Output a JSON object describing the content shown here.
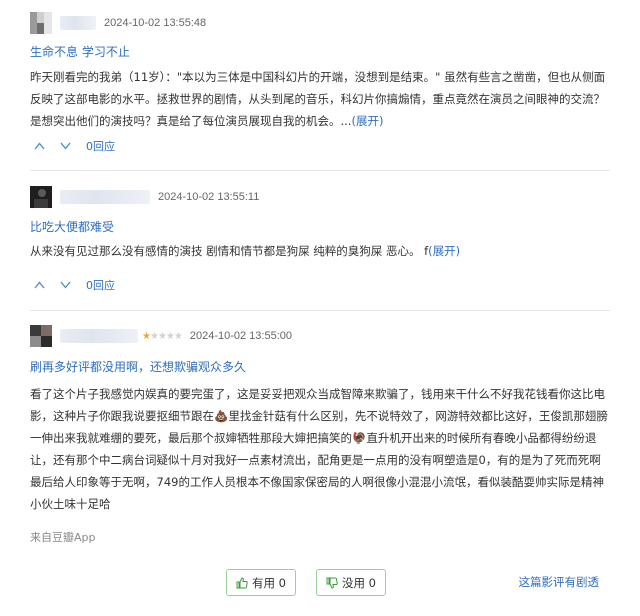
{
  "reviews": [
    {
      "time": "2024-10-02 13:55:48",
      "title": "生命不息 学习不止",
      "content": "昨天刚看完的我弟（11岁）：\"本以为三体是中国科幻片的开端，没想到是结束。\" 虽然有些言之凿凿，但也从侧面反映了这部电影的水平。拯救世界的剧情，从头到尾的音乐，科幻片你搞煽情，重点竟然在演员之间眼神的交流？是想突出他们的演技吗？真是给了每位演员展现自我的机会。...",
      "expand": "(展开)",
      "reply": "0回应"
    },
    {
      "time": "2024-10-02 13:55:11",
      "title": "比吃大便都难受",
      "content": "从来没有见过那么没有感情的演技 剧情和情节都是狗屎 纯粹的臭狗屎 恶心。 f",
      "expand": "(展开)",
      "reply": "0回应"
    },
    {
      "time": "2024-10-02 13:55:00",
      "rating": 1,
      "title": "刷再多好评都没用啊，还想欺骗观众多久",
      "content": "看了这个片子我感觉内娱真的要完蛋了，这是妥妥把观众当成智障来欺骗了，钱用来干什么不好我花钱看你这比电影，这种片子你跟我说要抠细节跟在💩里找金针菇有什么区别，先不说特效了，网游特效都比这好，王俊凯那翅膀一伸出来我就难绷的要死，最后那个叔婶牺牲那段大婶把搞笑的🦃直升机开出来的时候所有春晚小品都得纷纷退让，还有那个中二病台词疑似十月对我好一点素材流出，配角更是一点用的没有啊塑造是0，有的是为了死而死啊最后给人印象等于无啊，749的工作人员根本不像国家保密局的人啊很像小混混小流氓，看似装酷耍帅实际是精神小伙土味十足哈",
      "source": "来自豆瓣App"
    }
  ],
  "actions": {
    "useful": "有用 0",
    "useless": "没用 0",
    "report": "这篇影评有剧透"
  },
  "colors": {
    "link": "#2f6fbf",
    "star": "#f5a623",
    "button_border": "#9bd09b",
    "button_icon": "#3a9d3a"
  },
  "icons": {
    "up": "triangle-up-icon",
    "down": "triangle-down-icon",
    "thumb_up": "thumbs-up-icon",
    "thumb_down": "thumbs-down-icon"
  }
}
